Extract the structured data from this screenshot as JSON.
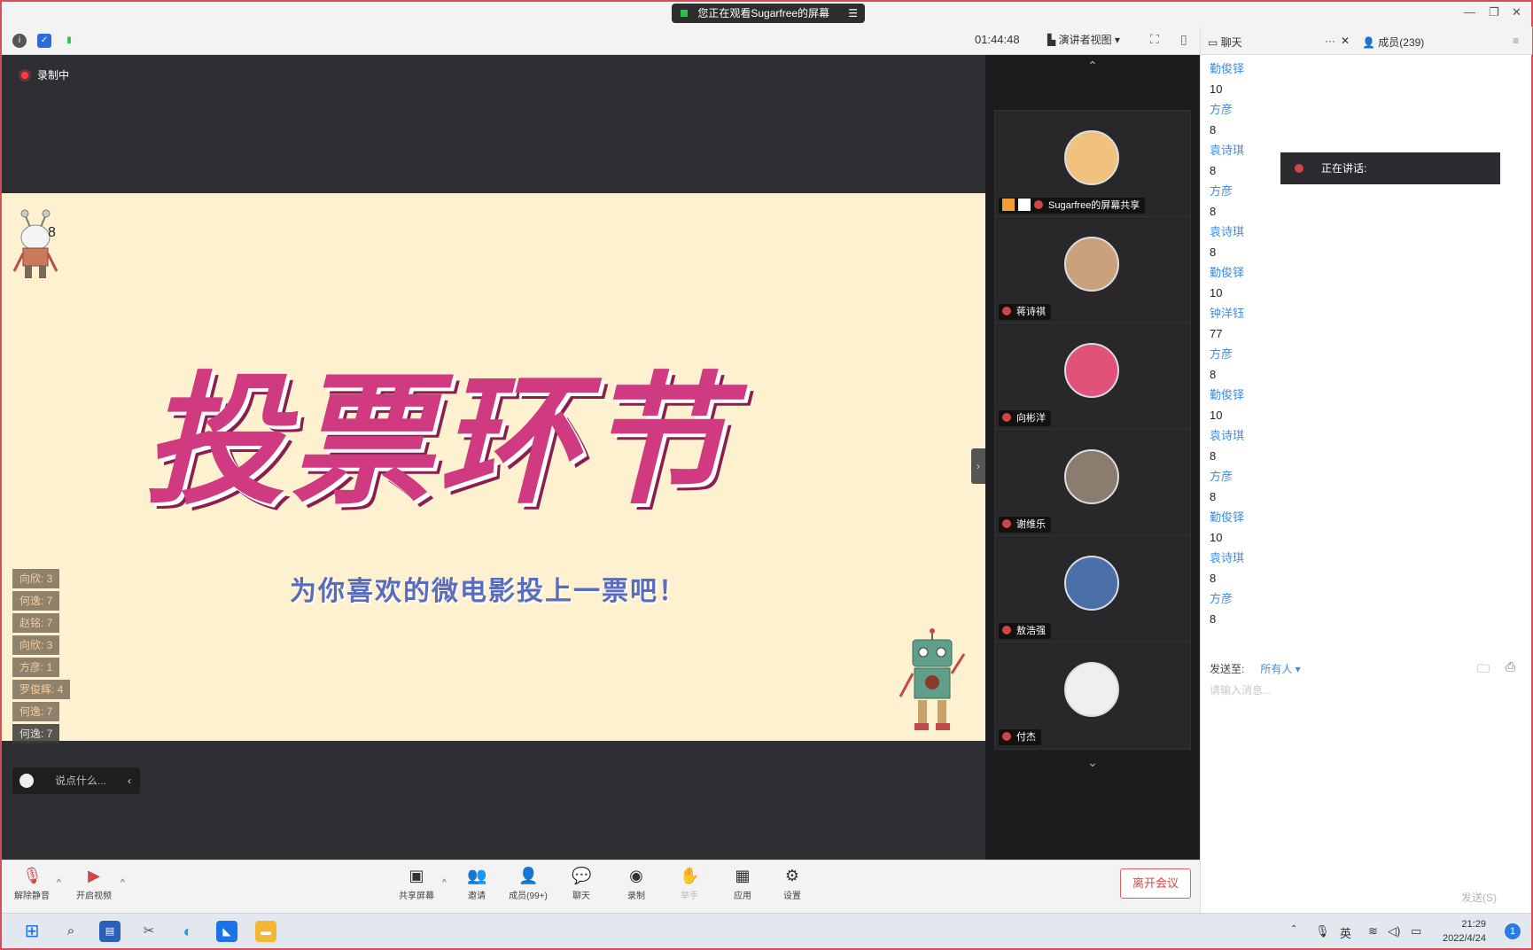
{
  "window": {
    "share_banner": "您正在观看Sugarfree的屏幕",
    "menu_glyph": "☰",
    "minimize": "—",
    "restore": "❐",
    "close": "✕"
  },
  "toolbar": {
    "timer": "01:44:48",
    "view_mode": "演讲者视图 ▾",
    "fullscreen_glyph": "⛶",
    "layout_glyph": "▯"
  },
  "share": {
    "recording_label": "录制中",
    "slide_title": "投票环节",
    "slide_subtitle": "为你喜欢的微电影投上一票吧！",
    "robot_label": "8",
    "expand_glyph": "›",
    "votes": [
      {
        "label": "向欣: 3"
      },
      {
        "label": "何逸: 7"
      },
      {
        "label": "赵铭: 7"
      },
      {
        "label": "向欣: 3"
      },
      {
        "label": "方彦: 1"
      },
      {
        "label": "罗俊辉: 4"
      },
      {
        "label": "何逸: 7"
      },
      {
        "label": "何逸: 7"
      }
    ],
    "say_placeholder": "说点什么...",
    "say_chevron": "‹"
  },
  "participants": {
    "up_glyph": "⌃",
    "down_glyph": "⌄",
    "tiles": [
      {
        "name": "Sugarfree的屏幕共享",
        "avatar_color": "#f1c27d"
      },
      {
        "name": "蒋诗祺",
        "avatar_color": "#c9a27c"
      },
      {
        "name": "向彬洋",
        "avatar_color": "#e0527a"
      },
      {
        "name": "谢维乐",
        "avatar_color": "#8a7d6f"
      },
      {
        "name": "敖浩强",
        "avatar_color": "#4a6fa8"
      },
      {
        "name": "付杰",
        "avatar_color": "#efefef"
      }
    ]
  },
  "chat": {
    "tab_chat": "聊天",
    "tab_more": "···",
    "tab_close": "✕",
    "tab_members": "成员(239)",
    "panel_menu": "≡",
    "messages": [
      {
        "name": "勤俊铎",
        "value": "10"
      },
      {
        "name": "方彦",
        "value": "8"
      },
      {
        "name": "袁诗琪",
        "value": "8"
      },
      {
        "name": "方彦",
        "value": "8"
      },
      {
        "name": "袁诗琪",
        "value": "8"
      },
      {
        "name": "勤俊铎",
        "value": "10"
      },
      {
        "name": "钟洋钰",
        "value": "77"
      },
      {
        "name": "方彦",
        "value": "8"
      },
      {
        "name": "勤俊铎",
        "value": "10"
      },
      {
        "name": "袁诗琪",
        "value": "8"
      },
      {
        "name": "方彦",
        "value": "8"
      },
      {
        "name": "勤俊铎",
        "value": "10"
      },
      {
        "name": "袁诗琪",
        "value": "8"
      },
      {
        "name": "方彦",
        "value": "8"
      }
    ],
    "speaking_label": "正在讲话:",
    "send_to_label": "发送至:",
    "send_to_target": "所有人 ▾",
    "input_placeholder": "请输入消息...",
    "send_button": "发送(S)",
    "file_glyph": "🗀",
    "screenshot_glyph": "⎙"
  },
  "controls": {
    "unmute": "解除静音",
    "start_video": "开启视频",
    "share_screen": "共享屏幕",
    "invite": "邀请",
    "members": "成员(99+)",
    "chat": "聊天",
    "record": "录制",
    "raise_hand": "举手",
    "apps": "应用",
    "settings": "设置",
    "leave": "离开会议",
    "caret": "^"
  },
  "taskbar": {
    "tray_ime": "英",
    "time": "21:29",
    "date": "2022/4/24",
    "notifications": "1"
  }
}
